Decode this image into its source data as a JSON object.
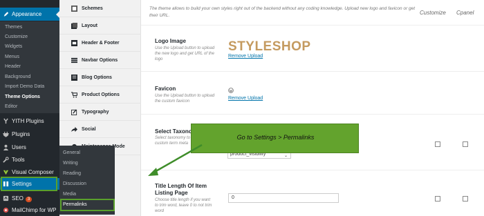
{
  "sidebar": {
    "current": "Appearance",
    "submenu": [
      "Themes",
      "Customize",
      "Widgets",
      "Menus",
      "Header",
      "Background",
      "Import Demo Data",
      "Theme Options",
      "Editor"
    ],
    "submenu_active": "Theme Options",
    "items": [
      {
        "label": "YITH Plugins",
        "icon": "yith-icon"
      },
      {
        "label": "Plugins",
        "icon": "plugin-icon"
      },
      {
        "label": "Users",
        "icon": "users-icon"
      },
      {
        "label": "Tools",
        "icon": "wrench-icon"
      },
      {
        "label": "Visual Composer",
        "icon": "visual-composer-icon"
      },
      {
        "label": "Settings",
        "icon": "settings-icon"
      },
      {
        "label": "SEO",
        "icon": "seo-icon",
        "badge": "3"
      },
      {
        "label": "MailChimp for WP",
        "icon": "mailchimp-icon"
      }
    ]
  },
  "flyout": {
    "items": [
      "General",
      "Writing",
      "Reading",
      "Discussion",
      "Media",
      "Permalinks"
    ]
  },
  "optnav": {
    "items": [
      {
        "label": "Schemes",
        "icon": "schemes-icon"
      },
      {
        "label": "Layout",
        "icon": "layout-icon"
      },
      {
        "label": "Header & Footer",
        "icon": "header-footer-icon"
      },
      {
        "label": "Navbar Options",
        "icon": "navbar-icon"
      },
      {
        "label": "Blog Options",
        "icon": "blog-icon"
      },
      {
        "label": "Product Options",
        "icon": "cart-icon"
      },
      {
        "label": "Typography",
        "icon": "typography-icon"
      },
      {
        "label": "Social",
        "icon": "share-icon"
      },
      {
        "label": "Maintenance Mode",
        "icon": "maintenance-icon"
      }
    ]
  },
  "main": {
    "description": "The theme allows to build your own styles right out of the backend without any coding knowledge. Upload new logo and favicon or get their URL.",
    "col_customize": "Customize",
    "col_cpanel": "Cpanel",
    "logo": {
      "title": "Logo Image",
      "desc": "Use the Upload button to upload the new logo and get URL of the logo",
      "logo_text": "STYLESHOP",
      "remove": "Remove Upload"
    },
    "favicon": {
      "title": "Favicon",
      "desc": "Use the Upload button to upload the custom favicon",
      "remove": "Remove Upload"
    },
    "taxonomy": {
      "title": "Select Taxonomy",
      "desc": "Select taxonomy to custom term meta",
      "select_value": "product_visibility"
    },
    "title_length": {
      "title": "Title Length Of Item Listing Page",
      "desc": "Choose title length if you want to trim word, leave 0 to not trim word",
      "value": "0"
    }
  },
  "callout": {
    "text": "Go to Settings > Permalinks"
  },
  "colors": {
    "wp_sidebar": "#23282d",
    "wp_active": "#0073aa",
    "highlight": "#5aa02c",
    "callout": "#63a32d",
    "logo": "#c49a5f"
  }
}
